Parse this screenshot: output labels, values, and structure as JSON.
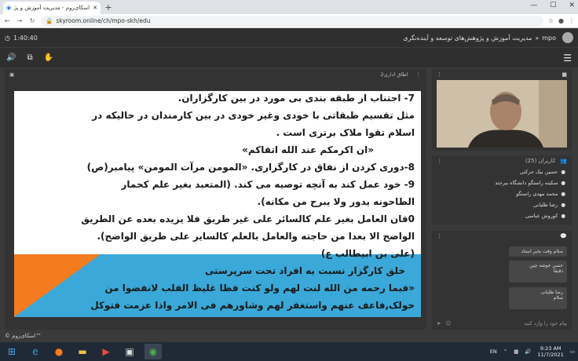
{
  "browser": {
    "tab_title": "اسکای‌روم - مدیریت آموزش و پژوه",
    "url": "skyroom.online/ch/mpo-skh/edu"
  },
  "app": {
    "timer": "1:40:40",
    "breadcrumb_root": "mpo",
    "breadcrumb_sep": "»",
    "breadcrumb_title": "مدیریت آموزش و پژوهش‌های توسعه و آینده‌نگری"
  },
  "main": {
    "room_label": "اطاق اداری2"
  },
  "slide": {
    "lines": [
      "7- اجتناب از طبقه بندی بی مورد در بین کارگزاران.",
      "مثل تقسیم طبقاتی با خودی وغیر خودی در بین کارمندان در حالیکه در",
      "اسلام تقوا ملاک برتری است .",
      "«ان اکرمکم عند الله اتقاکم»",
      "8-دوری کردن از نفاق در کارگزاری. «المومن مرآت المومن» پیامبر(ص)",
      "9- خود عمل کند به آنچه توصیه می کند. (المتعبد بغیر علم کحمار",
      "الطاحونه یدور ولا یبرح من مکانه).",
      "0قان العامل بغیر علم کالسائر علی غیر طریق فلا یزیده بعده عن الطریق",
      "الواضح الا بعدا من حاجته والعامل بالعلم کالسایر علی طریق الواضح).",
      "(علی بن ابیطالب ع)",
      "خلق کارگزار نسبت به افراد تحت سرپرستی",
      "«فبما رحمه من الله لنت لهم ولو کنت فظا غلیظ القلب لانفضوا من",
      "حولک,فاعف عنهم واستغفر لهم وشاورهم فی الامر واذا عزمت فتوکل"
    ]
  },
  "users": {
    "title": "کاربران (25)",
    "list": [
      "حسین نیک‌ حرکتی",
      "سکینه راستگو دانشگاه بیرجند",
      "محمد مهدی راستگو",
      "رضا طلیانی",
      "کوروش عباسی"
    ]
  },
  "chat": {
    "messages": [
      "سلام وقت بخیر استاد",
      "حسن خوشه چین\nدقیقا",
      "رضا طلیانی\nسلام"
    ],
    "input_placeholder": "پیام خود را وارد کنید"
  },
  "status": {
    "brand": "© اسکای‌روم™"
  },
  "taskbar": {
    "lang": "EN",
    "time": "9:23 AM",
    "date": "11/7/2021"
  }
}
